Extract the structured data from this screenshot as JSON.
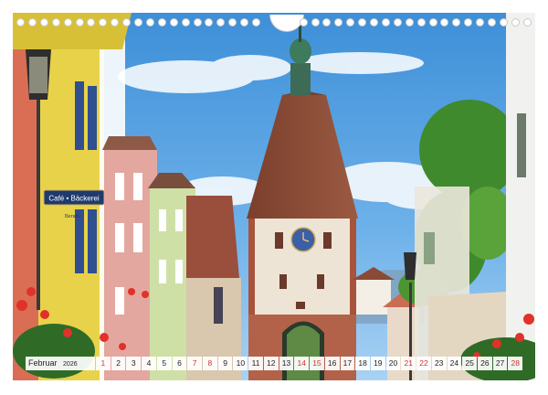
{
  "calendar": {
    "month_label": "Februar",
    "year": "2026",
    "days": [
      "1",
      "2",
      "3",
      "4",
      "5",
      "6",
      "7",
      "8",
      "9",
      "10",
      "11",
      "12",
      "13",
      "14",
      "15",
      "16",
      "17",
      "18",
      "19",
      "20",
      "21",
      "22",
      "23",
      "24",
      "25",
      "26",
      "27",
      "28"
    ],
    "weekend_days": [
      "1",
      "7",
      "8",
      "14",
      "15",
      "21",
      "22",
      "28"
    ]
  },
  "photo": {
    "sign_text": "Café • Bäckerei",
    "sign_subtext": "Beruth"
  },
  "colors": {
    "sky": "#4f9fe0",
    "tower_roof": "#8a4a35",
    "tower_wall": "#eee4d6",
    "weekend": "#d0342c"
  }
}
